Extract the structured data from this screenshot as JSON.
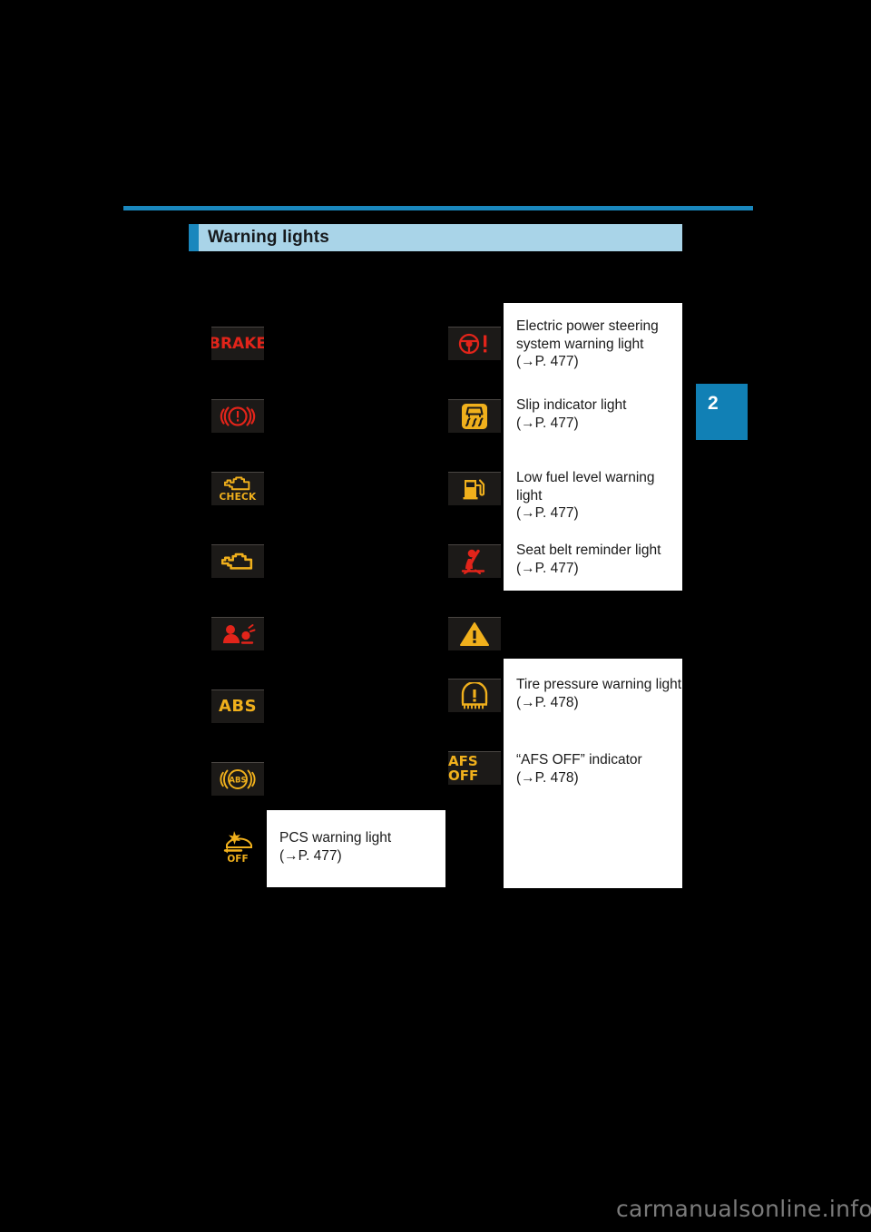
{
  "page": {
    "background_color": "#000000",
    "accent_color": "#1a87bd",
    "header_bar_color": "#a9d4e8",
    "watermark": "carmanualsonline.info"
  },
  "header": {
    "title": "Warning lights"
  },
  "chapter_tab": {
    "number": "2"
  },
  "icons_left": [
    {
      "name": "brake-system-warning-text-icon",
      "label": "BRAKE",
      "color": "#e2241a"
    },
    {
      "name": "brake-system-warning-icon",
      "label": "",
      "color": "#e2241a"
    },
    {
      "name": "check-engine-icon",
      "label": "CHECK",
      "color": "#f0b01c"
    },
    {
      "name": "engine-malfunction-icon",
      "label": "",
      "color": "#f0b01c"
    },
    {
      "name": "srs-airbag-warning-icon",
      "label": "",
      "color": "#e2241a"
    },
    {
      "name": "abs-warning-icon",
      "label": "ABS",
      "color": "#f0b01c"
    },
    {
      "name": "brake-assist-warning-icon",
      "label": "ABS",
      "color": "#f0b01c"
    },
    {
      "name": "pcs-warning-off-icon",
      "label": "OFF",
      "color": "#f0b01c"
    }
  ],
  "icons_right": [
    {
      "name": "electric-power-steering-warning-icon",
      "label": "",
      "color": "#e2241a"
    },
    {
      "name": "slip-indicator-icon",
      "label": "",
      "color": "#f0b01c"
    },
    {
      "name": "low-fuel-level-warning-icon",
      "label": "",
      "color": "#f0b01c"
    },
    {
      "name": "seat-belt-reminder-icon",
      "label": "",
      "color": "#e2241a"
    },
    {
      "name": "master-warning-icon",
      "label": "",
      "color": "#f0b01c"
    },
    {
      "name": "tire-pressure-warning-icon",
      "label": "",
      "color": "#f0b01c"
    },
    {
      "name": "afs-off-indicator-icon",
      "label": "AFS OFF",
      "color": "#f0b01c"
    }
  ],
  "callout_right_top": {
    "entries": [
      {
        "text": "Electric power steering\nsystem warning light\n(→P. 477)"
      },
      {
        "text": "Slip indicator light\n(→P. 477)"
      },
      {
        "text": "Low fuel level warning light\n(→P. 477)"
      },
      {
        "text": "Seat belt reminder light\n(→P. 477)"
      }
    ]
  },
  "callout_right_bottom": {
    "entries": [
      {
        "text": "Tire pressure warning light\n(→P. 478)"
      },
      {
        "text": "“AFS OFF” indicator\n(→P. 478)"
      }
    ]
  },
  "callout_left_bottom": {
    "entries": [
      {
        "text": "PCS warning light\n(→P. 477)"
      }
    ]
  }
}
